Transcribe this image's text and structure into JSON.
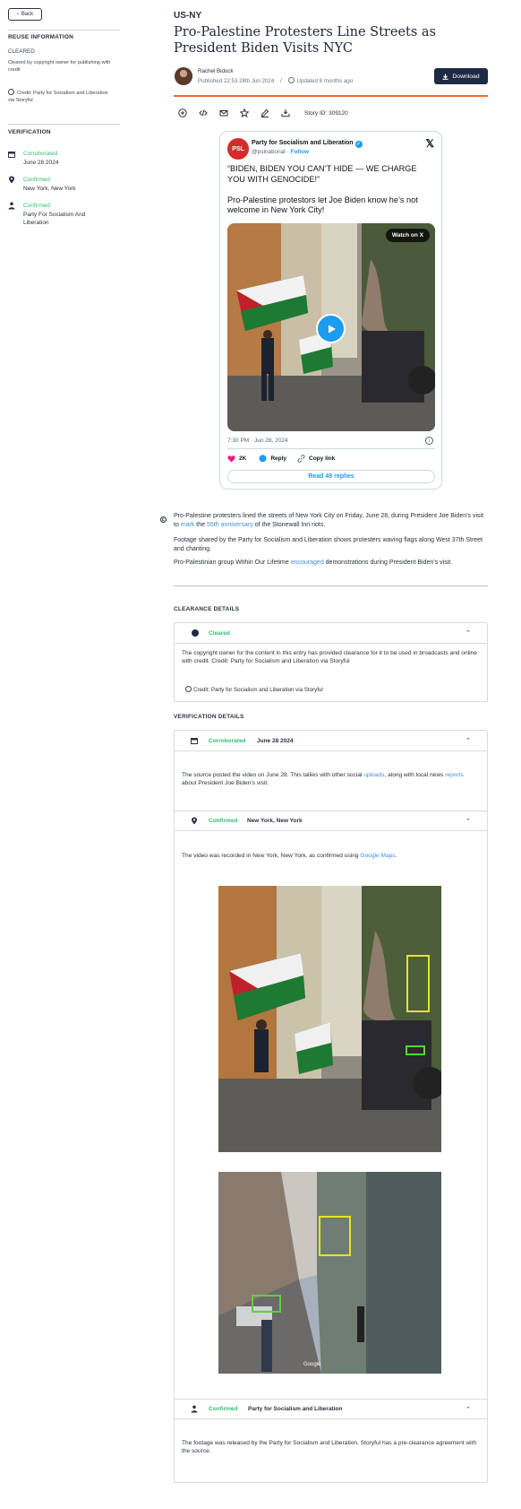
{
  "nav": {
    "back_label": "Back"
  },
  "sidebar": {
    "reuse_heading": "REUSE INFORMATION",
    "status": "CLEARED",
    "status_desc": "Cleared by copyright owner for publishing with credit",
    "credit": "Credit: Party for Socialism and Liberation via Storyful",
    "verification_heading": "VERIFICATION",
    "items": [
      {
        "icon": "calendar-icon",
        "label": "Corroborated",
        "value": "June 28 2024"
      },
      {
        "icon": "location-pin-icon",
        "label": "Confirmed",
        "value": "New York, New York"
      },
      {
        "icon": "person-icon",
        "label": "Confirmed",
        "value": "Party For Socialism And Liberation"
      }
    ]
  },
  "story": {
    "region": "US-NY",
    "title": "Pro-Palestine Protesters Line Streets as President Biden Visits NYC",
    "author": "Rachel Bidock",
    "published": "Published 22:53 28th Jun 2024",
    "separator": "/",
    "updated": "Updated 8 months ago",
    "download_label": "Download",
    "story_id": "Story ID: 309120"
  },
  "tweet": {
    "logo": "PSL",
    "name": "Party for Socialism and Liberation",
    "handle": "@pslnational",
    "dot": "·",
    "follow": "Follow",
    "text": "“BIDEN, BIDEN YOU CAN’T HIDE — WE CHARGE YOU WITH GENOCIDE!”\n\nPro-Palestine protestors let Joe Biden know he’s not welcome in New York City!",
    "watch_label": "Watch on X",
    "timestamp": "7:30 PM · Jun 28, 2024",
    "likes": "2K",
    "reply": "Reply",
    "copy_link": "Copy link",
    "read_replies": "Read 49 replies"
  },
  "body": {
    "p1_a": "Pro-Palestine protesters lined the streets of New York City on Friday, June 28, during President Joe Biden’s visit to ",
    "p1_link1": "mark",
    "p1_b": " the ",
    "p1_link2": "55th anniversary",
    "p1_c": " of the Stonewall Inn riots.",
    "p2": "Footage shared by the Party for Socialism and Liberation shows protesters waving flags along West 37th Street and chanting.",
    "p3_a": "Pro-Palestinian group Within Our Lifetime ",
    "p3_link": "encouraged",
    "p3_b": " demonstrations during President Biden’s visit."
  },
  "clearance": {
    "heading": "CLEARANCE DETAILS",
    "status": "Cleared",
    "text": "The copyright owner for the content in this entry has provided clearance for it to be used in broadcasts and online with credit. Credit: Party for Socialism and Liberation via Storyful",
    "credit": "Credit: Party for Socialism and Liberation via Storyful"
  },
  "verification": {
    "heading": "VERIFICATION DETAILS",
    "date": {
      "status": "Corroborated",
      "value": "June 28 2024",
      "text_a": "The source posted the video on June 28. This tallies with other social ",
      "link1": "uploads",
      "text_b": ", along with local news ",
      "link2": "reports",
      "text_c": " about President Joe Biden’s visit."
    },
    "location": {
      "status": "Confirmed",
      "value": "New York, New York",
      "text_a": "The video was recorded in New York, New York, as confirmed using ",
      "link": "Google Maps",
      "text_b": "."
    },
    "source": {
      "status": "Confirmed",
      "value": "Party for Socialism and Liberation",
      "text": "The footage was released by the Party for Socialism and Liberation. Storyful has a pre-clearance agreement with the source."
    },
    "map_label": "Google"
  },
  "colors": {
    "accent_green": "#2fbf71",
    "brand_navy": "#1f2a44",
    "divider_orange": "#f26a3a",
    "link_blue": "#3f8fd8",
    "x_blue": "#1d9bf0"
  }
}
